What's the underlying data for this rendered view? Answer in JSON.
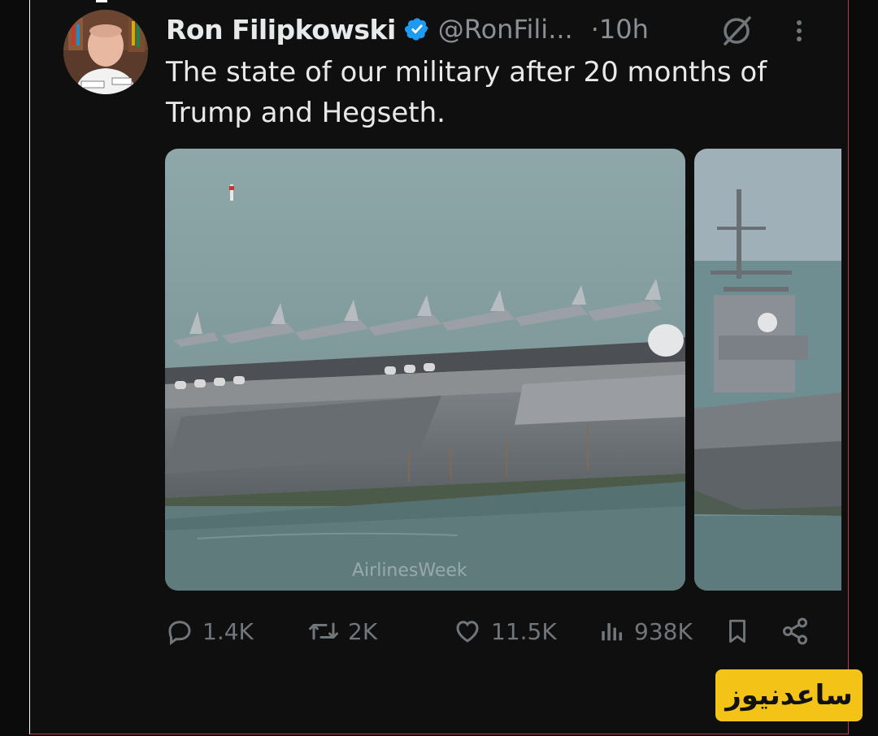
{
  "tweet": {
    "author_name": "Ron Filipkowski",
    "handle": "@RonFili...",
    "time": "·10h",
    "text": "The state of our military after 20 months of Trump and Hegseth.",
    "verified": true
  },
  "media": {
    "watermark": "AirlinesWeek"
  },
  "actions": {
    "replies": "1.4K",
    "reposts": "2K",
    "likes": "11.5K",
    "views": "938K"
  },
  "badge": {
    "text": "ساعدنیوز"
  },
  "icons": {
    "verified": "verified-badge-icon",
    "grok": "grok-icon",
    "more": "more-icon",
    "reply": "reply-icon",
    "repost": "repost-icon",
    "like": "heart-icon",
    "views": "views-icon",
    "bookmark": "bookmark-icon",
    "share": "share-icon"
  },
  "colors": {
    "background": "#0f0f0f",
    "text": "#e7e9ea",
    "muted": "#71767b",
    "verified_blue": "#1d9bf0",
    "badge_yellow": "#f3c417"
  }
}
